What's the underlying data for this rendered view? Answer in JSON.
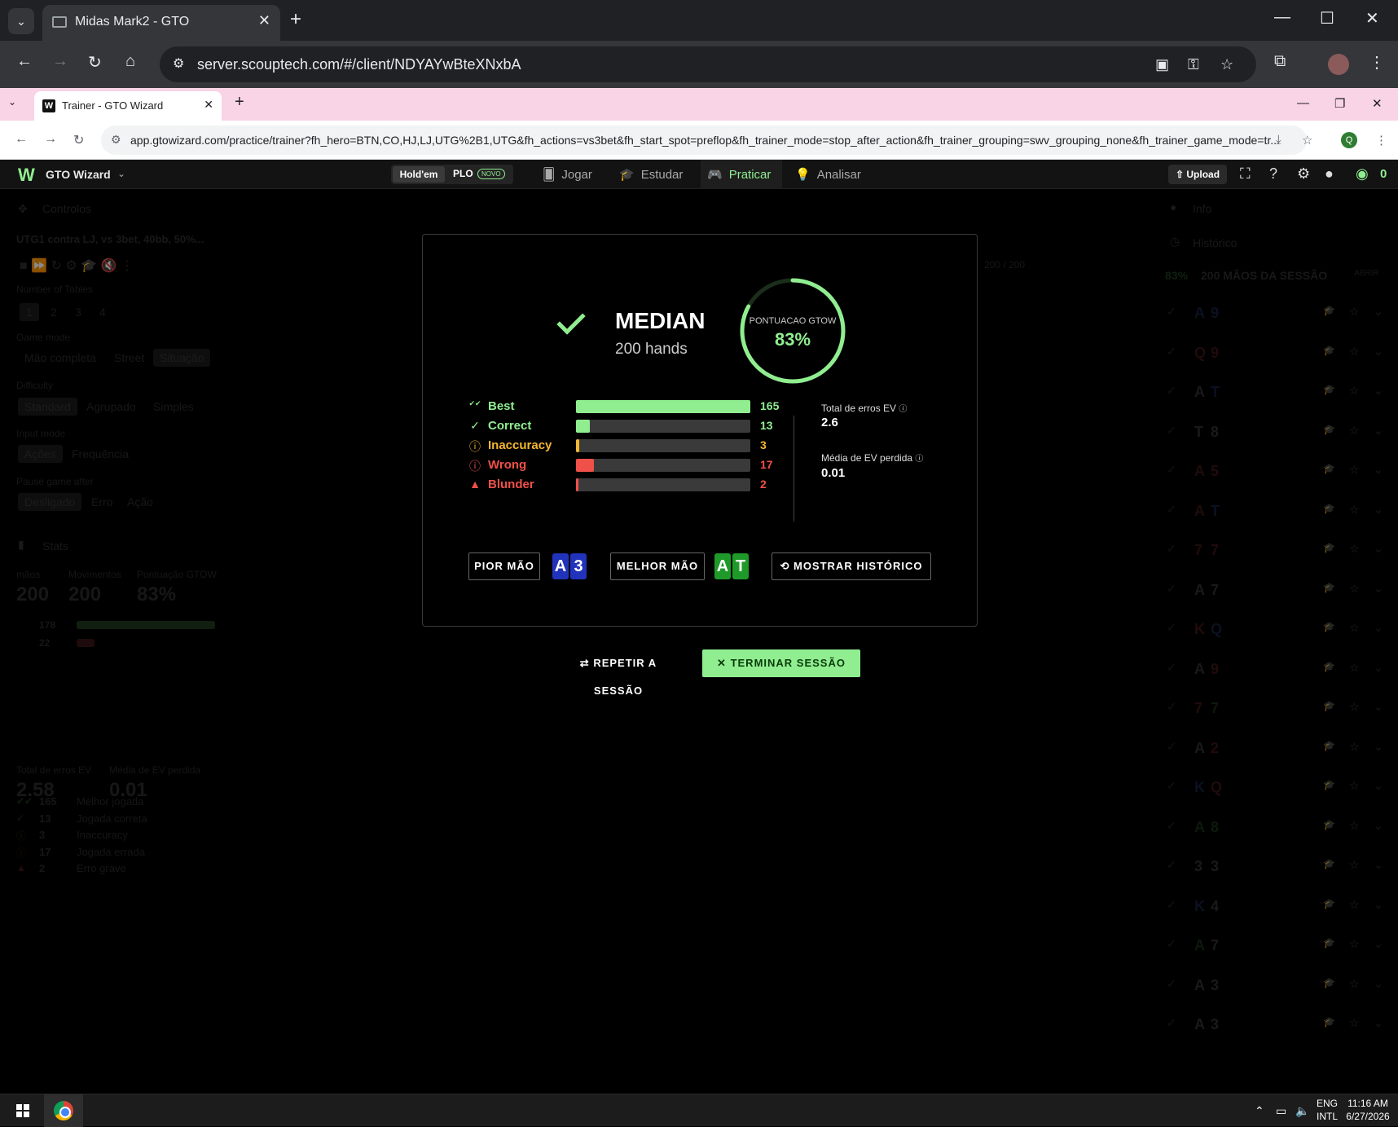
{
  "outer_browser": {
    "tab_title": "Midas Mark2 - GTO",
    "url": "server.scouptech.com/#/client/NDYAYwBteXNxbA"
  },
  "inner_browser": {
    "tab_title": "Trainer - GTO Wizard",
    "url": "app.gtowizard.com/practice/trainer?fh_hero=BTN,CO,HJ,LJ,UTG%2B1,UTG&fh_actions=vs3bet&fh_start_spot=preflop&fh_trainer_mode=stop_after_action&fh_trainer_grouping=swv_grouping_none&fh_trainer_game_mode=tr...",
    "profile_initial": "Q"
  },
  "app_header": {
    "brand": "GTO Wizard",
    "holdem": "Hold'em",
    "plo": "PLO",
    "novo": "NOVO",
    "nav": {
      "jogar": "Jogar",
      "estudar": "Estudar",
      "praticar": "Praticar",
      "analisar": "Analisar"
    },
    "upload": "Upload",
    "coins": "0"
  },
  "left_panel": {
    "controls_title": "Controlos",
    "spot_title": "UTG1 contra LJ, vs 3bet, 40bb, 50%...",
    "tables_label": "Number of Tables",
    "tables": [
      "1",
      "2",
      "3",
      "4"
    ],
    "game_mode_label": "Game mode",
    "game_modes": [
      "Mão completa",
      "Street",
      "Situação"
    ],
    "difficulty_label": "Difficulty",
    "difficulties": [
      "Standard",
      "Agrupado",
      "Simples"
    ],
    "input_mode_label": "Input mode",
    "input_modes": [
      "Ações",
      "Frequência"
    ],
    "pause_label": "Pause game after",
    "pause_options": [
      "Desligado",
      "Erro",
      "Ação"
    ],
    "stats_title": "Stats",
    "stat_headers": [
      "mãos",
      "Movimentos",
      "Pontuação GTOW"
    ],
    "stat_values": [
      "200",
      "200",
      "83%"
    ],
    "good_count": "178",
    "bad_count": "22",
    "breakdown": [
      {
        "count": "165",
        "label": "Melhor jogada"
      },
      {
        "count": "13",
        "label": "Jogada correta"
      },
      {
        "count": "3",
        "label": "Inaccuracy"
      },
      {
        "count": "17",
        "label": "Jogada errada"
      },
      {
        "count": "2",
        "label": "Erro grave"
      }
    ],
    "ev_total_label": "Total de erros EV",
    "ev_avg_label": "Média de EV perdida",
    "ev_total": "2.58",
    "ev_avg": "0.01",
    "progress": "200 / 200"
  },
  "right_panel": {
    "info_title": "Info",
    "history_title": "Histórico",
    "session_pct": "83%",
    "session_label": "200 MÃOS DA SESSÃO",
    "open": "ABRIR",
    "hands": [
      {
        "c1": "A",
        "c2": "9",
        "col1": "#3a5aa8",
        "col2": "#3a5aa8"
      },
      {
        "c1": "Q",
        "c2": "9",
        "col1": "#a83a3a",
        "col2": "#a83a3a"
      },
      {
        "c1": "A",
        "c2": "T",
        "col1": "#888",
        "col2": "#3a5aa8"
      },
      {
        "c1": "T",
        "c2": "8",
        "col1": "#888",
        "col2": "#888"
      },
      {
        "c1": "A",
        "c2": "5",
        "col1": "#a83a3a",
        "col2": "#a83a3a"
      },
      {
        "c1": "A",
        "c2": "T",
        "col1": "#a83a3a",
        "col2": "#3a5aa8"
      },
      {
        "c1": "7",
        "c2": "7",
        "col1": "#a83a3a",
        "col2": "#a83a3a"
      },
      {
        "c1": "A",
        "c2": "7",
        "col1": "#888",
        "col2": "#888"
      },
      {
        "c1": "K",
        "c2": "Q",
        "col1": "#a83a3a",
        "col2": "#3a5aa8"
      },
      {
        "c1": "A",
        "c2": "9",
        "col1": "#888",
        "col2": "#a83a3a"
      },
      {
        "c1": "7",
        "c2": "7",
        "col1": "#a83a3a",
        "col2": "#3a8a3a"
      },
      {
        "c1": "A",
        "c2": "2",
        "col1": "#888",
        "col2": "#a83a3a"
      },
      {
        "c1": "K",
        "c2": "Q",
        "col1": "#3a5aa8",
        "col2": "#a83a3a"
      },
      {
        "c1": "A",
        "c2": "8",
        "col1": "#3a8a3a",
        "col2": "#3a8a3a"
      },
      {
        "c1": "3",
        "c2": "3",
        "col1": "#888",
        "col2": "#888"
      },
      {
        "c1": "K",
        "c2": "4",
        "col1": "#3a5aa8",
        "col2": "#888"
      },
      {
        "c1": "A",
        "c2": "7",
        "col1": "#3a8a3a",
        "col2": "#888"
      },
      {
        "c1": "A",
        "c2": "3",
        "col1": "#888",
        "col2": "#888"
      },
      {
        "c1": "A",
        "c2": "3",
        "col1": "#888",
        "col2": "#888"
      }
    ]
  },
  "modal": {
    "result": "MEDIAN",
    "hands_label": "200 hands",
    "score_label": "PONTUACAO GTOW",
    "score_value": "83%",
    "score_fraction": 0.83,
    "stats": [
      {
        "name": "Best",
        "count": "165",
        "fraction": 1.0,
        "color": "#90ee90",
        "icon": "double-check-icon"
      },
      {
        "name": "Correct",
        "count": "13",
        "fraction": 0.079,
        "color": "#90ee90",
        "icon": "check-icon"
      },
      {
        "name": "Inaccuracy",
        "count": "3",
        "fraction": 0.018,
        "color": "#f5b731",
        "icon": "info-circle-icon"
      },
      {
        "name": "Wrong",
        "count": "17",
        "fraction": 0.103,
        "color": "#f0504a",
        "icon": "alert-circle-icon"
      },
      {
        "name": "Blunder",
        "count": "2",
        "fraction": 0.012,
        "color": "#f0504a",
        "icon": "warning-triangle-icon"
      }
    ],
    "ev_total_label": "Total de erros EV",
    "ev_total": "2.6",
    "ev_avg_label": "Média de EV perdida",
    "ev_avg": "0.01",
    "worst_label": "PIOR MÃO",
    "worst_cards": [
      {
        "rank": "A",
        "color": "#2233bb"
      },
      {
        "rank": "3",
        "color": "#2233bb"
      }
    ],
    "best_label": "MELHOR MÃO",
    "best_cards": [
      {
        "rank": "A",
        "color": "#1f9a2a"
      },
      {
        "rank": "T",
        "color": "#1f9a2a"
      }
    ],
    "history_label": "MOSTRAR HISTÓRICO"
  },
  "actions": {
    "repeat": "REPETIR A SESSÃO",
    "end": "TERMINAR SESSÃO"
  },
  "taskbar": {
    "lang1": "ENG",
    "lang2": "INTL",
    "time": "11:16 AM",
    "date": "6/27/2026"
  }
}
